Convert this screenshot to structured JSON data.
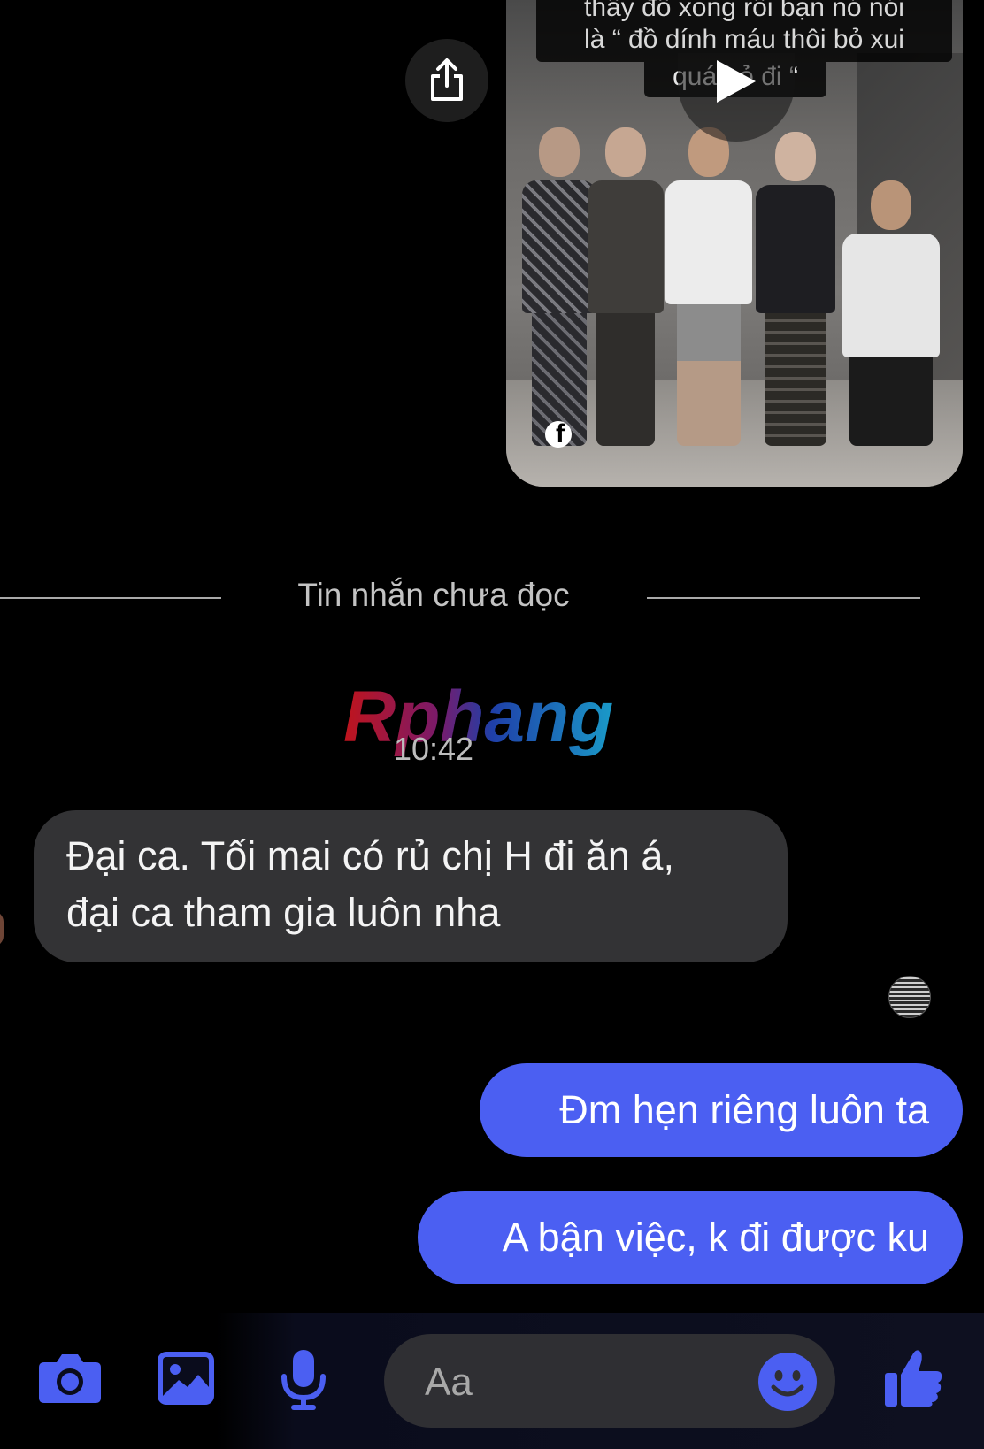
{
  "shared_video": {
    "caption_line_1": "thấy đồ xong rồi bạn nó nói",
    "caption_line_2": "là “ đồ dính máu thôi bỏ xui",
    "caption_line_3": "quá bỏ đi “",
    "source_badge": "f"
  },
  "divider": {
    "label": "Tin nhắn chưa đọc"
  },
  "watermark": "Rphang",
  "timestamp": "10:42",
  "messages": [
    {
      "direction": "incoming",
      "lines": [
        "Đại ca. Tối mai có rủ chị H đi ăn á,",
        "đại ca tham gia luôn nha"
      ]
    },
    {
      "direction": "outgoing",
      "text": "Đm hẹn riêng luôn ta"
    },
    {
      "direction": "outgoing",
      "text": "A bận việc, k đi được ku"
    }
  ],
  "composer": {
    "placeholder": "Aa",
    "icons": [
      "camera-icon",
      "image-icon",
      "microphone-icon",
      "emoji-icon",
      "thumbs-up-icon"
    ],
    "accent_color": "#4b5ff2"
  },
  "colors": {
    "background": "#000000",
    "incoming_bubble": "#333335",
    "outgoing_bubble": "#4b5ff2",
    "input_bg": "#2f2f33"
  }
}
